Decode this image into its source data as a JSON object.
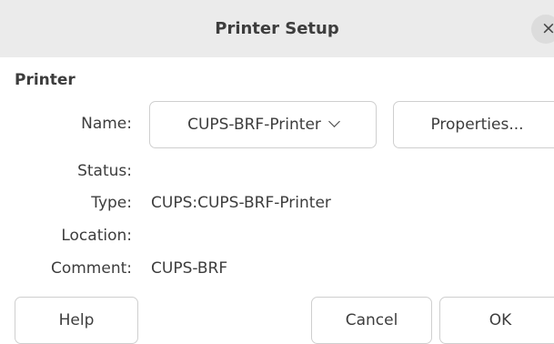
{
  "dialog": {
    "title": "Printer Setup",
    "close_glyph": "×"
  },
  "printer": {
    "section_label": "Printer",
    "name_label": "Name:",
    "name_value": "CUPS-BRF-Printer",
    "properties_label": "Properties...",
    "status_label": "Status:",
    "status_value": "",
    "type_label": "Type:",
    "type_value": "CUPS:CUPS-BRF-Printer",
    "location_label": "Location:",
    "location_value": "",
    "comment_label": "Comment:",
    "comment_value": "CUPS-BRF"
  },
  "buttons": {
    "help": "Help",
    "cancel": "Cancel",
    "ok": "OK"
  },
  "icons": {
    "close": "close-icon",
    "dropdown": "chevron-down-icon"
  },
  "colors": {
    "titlebar_bg": "#ebebeb",
    "text": "#3d3d3d",
    "button_border": "#cfcfcf"
  }
}
